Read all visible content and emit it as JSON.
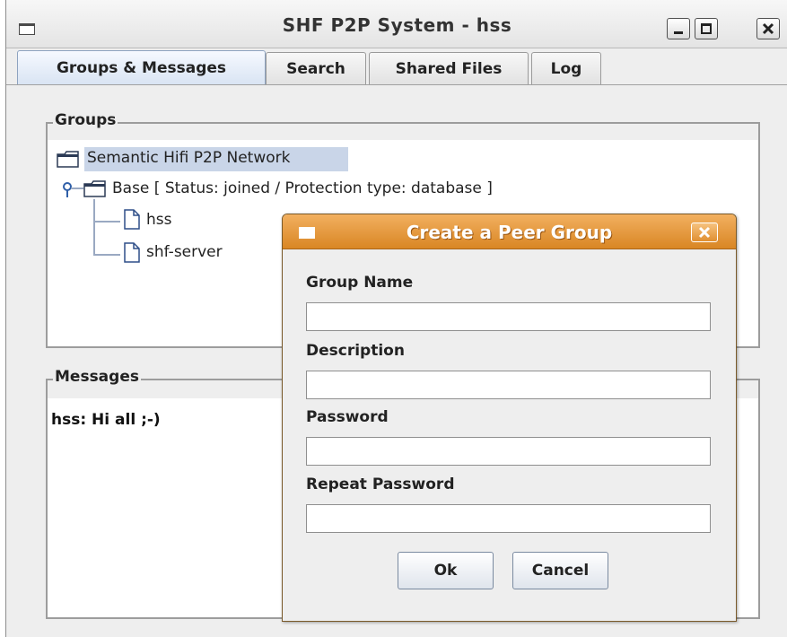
{
  "window": {
    "title": "SHF P2P System - hss",
    "tabs": [
      {
        "label": "Groups & Messages",
        "active": true
      },
      {
        "label": "Search",
        "active": false
      },
      {
        "label": "Shared Files",
        "active": false
      },
      {
        "label": "Log",
        "active": false
      }
    ]
  },
  "groups_panel": {
    "title": "Groups",
    "tree": {
      "root": "Semantic Hifi P2P Network",
      "child": "Base [ Status: joined / Protection type: database ]",
      "leaves": [
        "hss",
        "shf-server"
      ]
    }
  },
  "messages_panel": {
    "title": "Messages",
    "messages": [
      "hss: Hi all ;-)"
    ]
  },
  "dialog": {
    "title": "Create a Peer Group",
    "fields": [
      {
        "label": "Group Name",
        "value": "",
        "placeholder": ""
      },
      {
        "label": "Description",
        "value": "",
        "placeholder": ""
      },
      {
        "label": "Password",
        "value": "",
        "placeholder": ""
      },
      {
        "label": "Repeat Password",
        "value": "",
        "placeholder": ""
      }
    ],
    "ok_label": "Ok",
    "cancel_label": "Cancel"
  },
  "icons": {
    "window": "window-menu-icon",
    "minimize": "minimize-icon",
    "maximize": "maximize-icon",
    "close": "close-icon",
    "folder": "folder-icon",
    "file": "file-icon",
    "tree_handle": "tree-expand-handle-icon"
  },
  "colors": {
    "dialog_titlebar": "#e0922f",
    "selection": "#c9d5e8",
    "active_tab": "#d9e4f3"
  }
}
